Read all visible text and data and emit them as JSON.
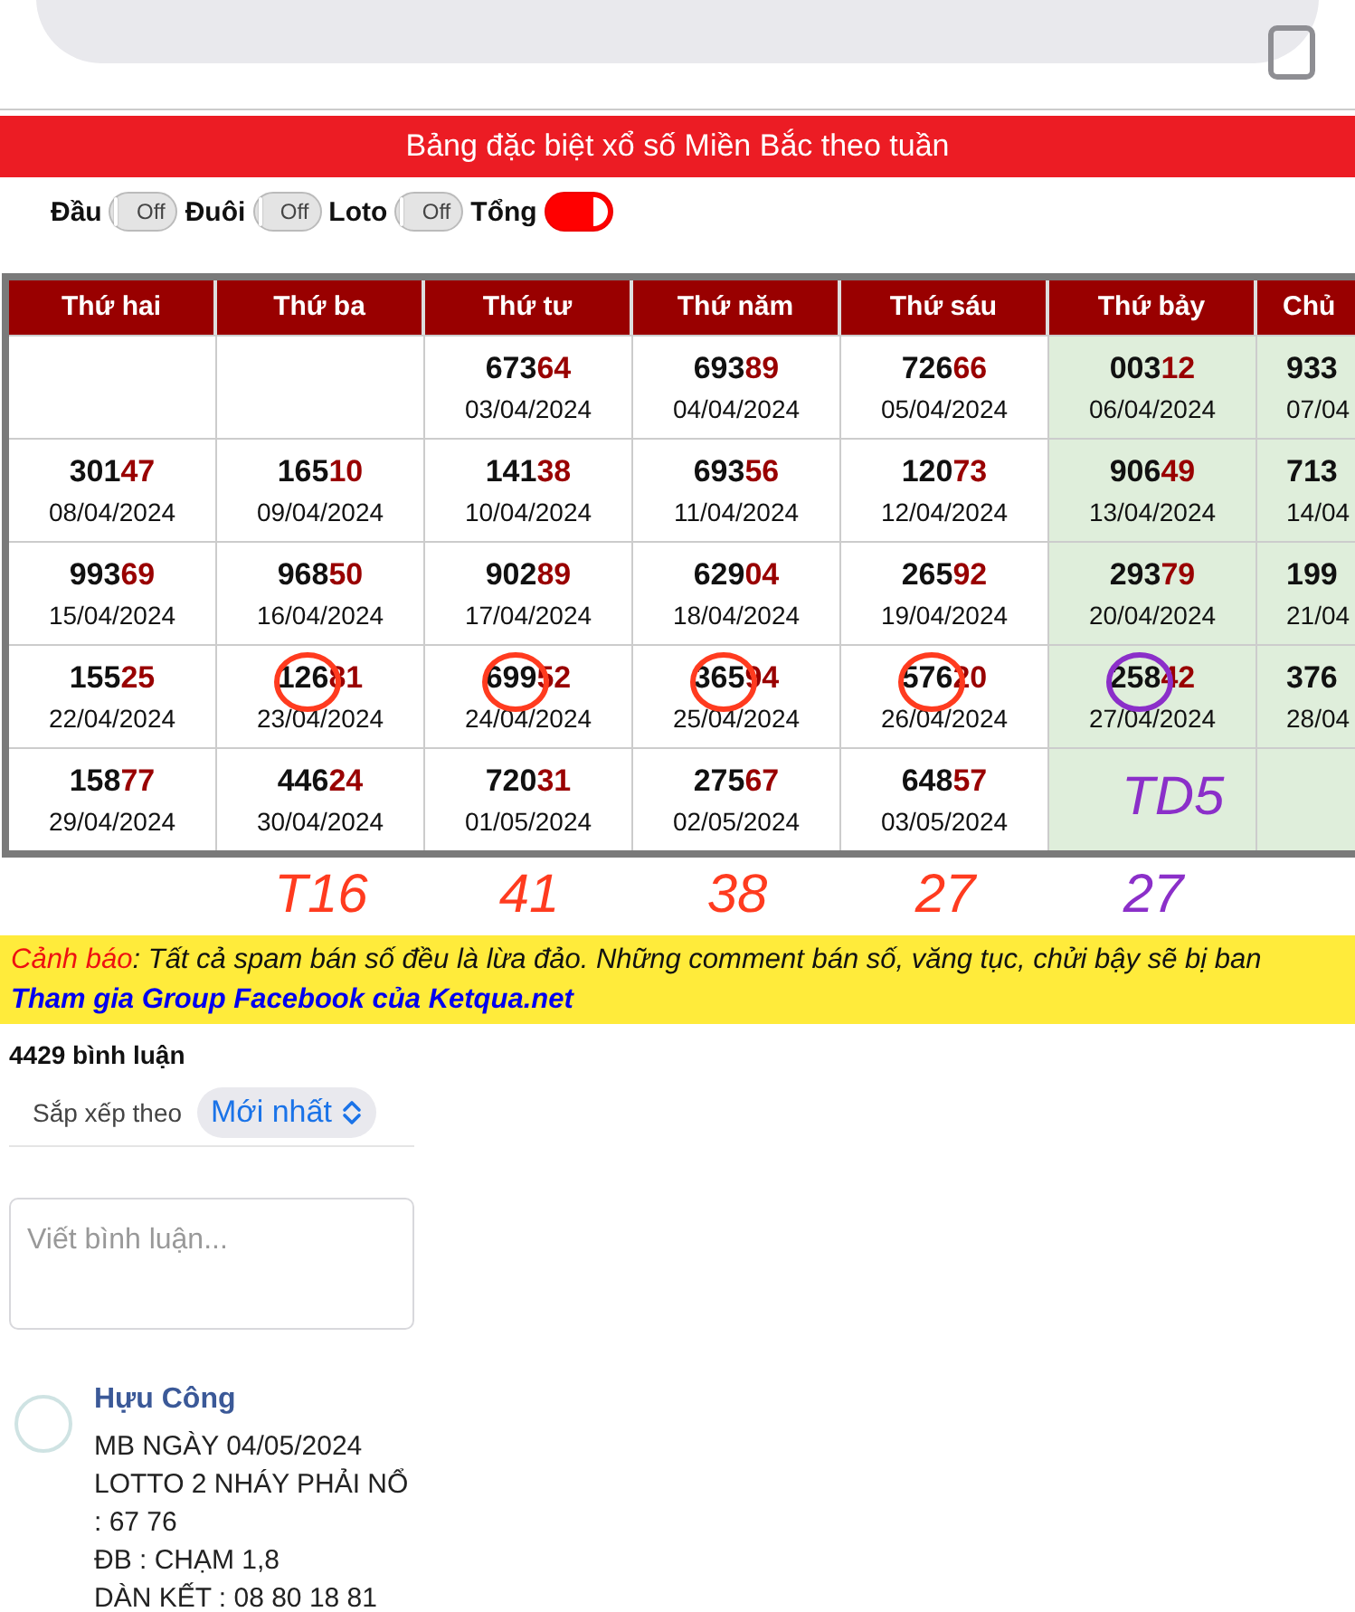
{
  "banner": {
    "title": "Bảng đặc biệt xổ số Miền Bắc theo tuần"
  },
  "toggles": [
    {
      "label": "Đầu",
      "on": false,
      "state_text": "Off"
    },
    {
      "label": "Đuôi",
      "on": false,
      "state_text": "Off"
    },
    {
      "label": "Loto",
      "on": false,
      "state_text": "Off"
    },
    {
      "label": "Tổng",
      "on": true
    }
  ],
  "table": {
    "columns": [
      {
        "label": "Thứ hai",
        "weekend": false
      },
      {
        "label": "Thứ ba",
        "weekend": false
      },
      {
        "label": "Thứ tư",
        "weekend": false
      },
      {
        "label": "Thứ năm",
        "weekend": false
      },
      {
        "label": "Thứ sáu",
        "weekend": false
      },
      {
        "label": "Thứ bảy",
        "weekend": true
      },
      {
        "label": "Chủ",
        "weekend": true
      }
    ],
    "rows": [
      {
        "cells": [
          {},
          {},
          {
            "number": "67364",
            "date": "03/04/2024"
          },
          {
            "number": "69389",
            "date": "04/04/2024"
          },
          {
            "number": "72666",
            "date": "05/04/2024"
          },
          {
            "number": "00312",
            "date": "06/04/2024"
          },
          {
            "number": "933",
            "date": "07/04"
          }
        ]
      },
      {
        "cells": [
          {
            "number": "30147",
            "date": "08/04/2024"
          },
          {
            "number": "16510",
            "date": "09/04/2024"
          },
          {
            "number": "14138",
            "date": "10/04/2024"
          },
          {
            "number": "69356",
            "date": "11/04/2024"
          },
          {
            "number": "12073",
            "date": "12/04/2024"
          },
          {
            "number": "90649",
            "date": "13/04/2024"
          },
          {
            "number": "713",
            "date": "14/04"
          }
        ]
      },
      {
        "cells": [
          {
            "number": "99369",
            "date": "15/04/2024"
          },
          {
            "number": "96850",
            "date": "16/04/2024"
          },
          {
            "number": "90289",
            "date": "17/04/2024"
          },
          {
            "number": "62904",
            "date": "18/04/2024"
          },
          {
            "number": "26592",
            "date": "19/04/2024"
          },
          {
            "number": "29379",
            "date": "20/04/2024"
          },
          {
            "number": "199",
            "date": "21/04"
          }
        ]
      },
      {
        "cells": [
          {
            "number": "15525",
            "date": "22/04/2024"
          },
          {
            "number": "12681",
            "date": "23/04/2024",
            "circle": {
              "color": "#ff3b1f"
            }
          },
          {
            "number": "69952",
            "date": "24/04/2024",
            "circle": {
              "color": "#ff3b1f"
            }
          },
          {
            "number": "36594",
            "date": "25/04/2024",
            "circle": {
              "color": "#ff3b1f"
            }
          },
          {
            "number": "57620",
            "date": "26/04/2024",
            "circle": {
              "color": "#ff3b1f"
            }
          },
          {
            "number": "25842",
            "date": "27/04/2024",
            "circle": {
              "color": "#8b2fc9"
            }
          },
          {
            "number": "376",
            "date": "28/04"
          }
        ]
      },
      {
        "cells": [
          {
            "number": "15877",
            "date": "29/04/2024"
          },
          {
            "number": "44624",
            "date": "30/04/2024"
          },
          {
            "number": "72031",
            "date": "01/05/2024"
          },
          {
            "number": "27567",
            "date": "02/05/2024"
          },
          {
            "number": "64857",
            "date": "03/05/2024"
          },
          {
            "note": {
              "text": "TD5",
              "color": "#8b2fc9"
            }
          },
          {}
        ]
      }
    ]
  },
  "handwriting_below_table": [
    {
      "text": "T16",
      "color": "#ff3b1f"
    },
    {
      "text": "41",
      "color": "#ff3b1f"
    },
    {
      "text": "38",
      "color": "#ff3b1f"
    },
    {
      "text": "27",
      "color": "#ff3b1f"
    },
    {
      "text": "27",
      "color": "#8b2fc9"
    }
  ],
  "warning": {
    "label": "Cảnh báo",
    "message": ": Tất cả spam bán số đều là lừa đảo. Những comment bán số, văng tục, chửi bậy sẽ bị ban",
    "link": "Tham gia Group Facebook của Ketqua.net"
  },
  "comments": {
    "count": "4429 bình luận",
    "sort_label": "Sắp xếp theo",
    "sort_value": "Mới nhất",
    "placeholder": "Viết bình luận...",
    "items": [
      {
        "author": "Hựu Công",
        "lines": [
          "MB NGÀY 04/05/2024",
          "LOTTO 2 NHÁY PHẢI NỔ",
          ": 67 76",
          "ĐB : CHẠM 1,8",
          "DÀN KẾT : 08 80 18 81"
        ]
      }
    ]
  }
}
